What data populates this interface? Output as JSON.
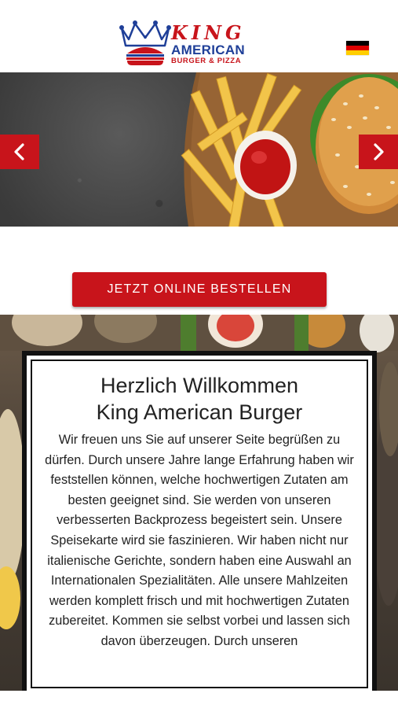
{
  "header": {
    "logo": {
      "line1": "KING",
      "line2": "AMERICAN",
      "line3": "BURGER & PIZZA",
      "icon": "crown-burger-logo"
    },
    "language_flag": {
      "icon": "germany-flag-icon",
      "colors": [
        "#000000",
        "#dd0000",
        "#ffce00"
      ]
    }
  },
  "hero": {
    "image": "burger-fries-ketchup-photo",
    "prev_icon": "chevron-left-icon",
    "next_icon": "chevron-right-icon"
  },
  "order": {
    "button_label": "JETZT ONLINE BESTELLEN"
  },
  "welcome": {
    "title_line1": "Herzlich Willkommen",
    "title_line2": "King American Burger",
    "text": "Wir freuen uns Sie auf unserer Seite begrüßen zu dürfen. Durch unsere Jahre lange Erfahrung haben wir feststellen können, welche hochwertigen Zutaten am besten geeignet sind. Sie werden von unseren verbesserten Backprozess begeistert sein. Unsere Speisekarte wird sie faszinieren. Wir haben nicht nur italienische Gerichte, sondern haben eine Auswahl an Internationalen Spezialitäten. Alle unsere Mahlzeiten werden komplett frisch und mit hochwertigen Zutaten zubereitet. Kommen sie selbst vorbei und lassen sich davon überzeugen. Durch unseren"
  },
  "colors": {
    "accent": "#c8141b",
    "brand_blue": "#1f3f98"
  }
}
